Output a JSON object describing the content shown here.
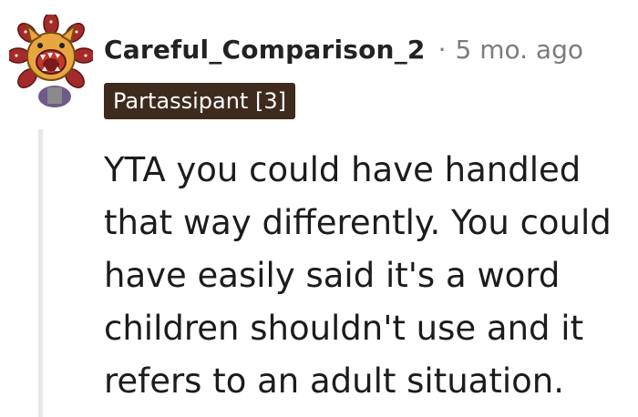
{
  "comment": {
    "username": "Careful_Comparison_2",
    "separator": "·",
    "timestamp": "5 mo. ago",
    "flair": "Partassipant [3]",
    "body": "YTA you could have handled that way differently. You could have easily said it's a word children shouldn't use and it refers to an adult situation."
  },
  "avatar": {
    "icon": "dog-avatar-icon",
    "colors": {
      "face": "#e8a640",
      "petals": "#a52a2a",
      "mouth": "#c0392b",
      "body": "#6f5a8a"
    }
  }
}
